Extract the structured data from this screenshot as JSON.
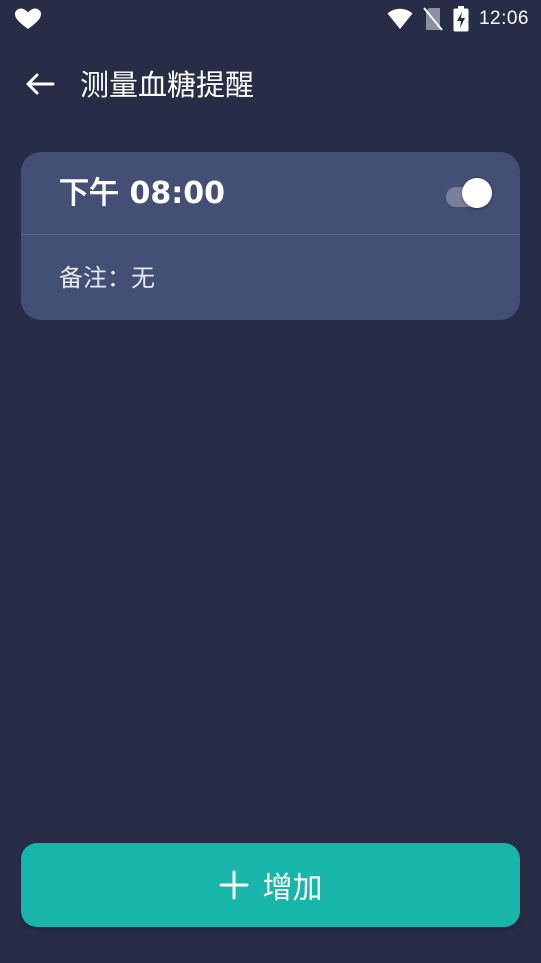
{
  "status_bar": {
    "time": "12:06",
    "icons": [
      "app-heart-icon",
      "wifi-icon",
      "no-sim-icon",
      "battery-charging-icon"
    ]
  },
  "toolbar": {
    "title": "测量血糖提醒",
    "back_icon": "arrow-left-icon"
  },
  "reminders": [
    {
      "time": "下午 08:00",
      "enabled": true,
      "note": "备注：无"
    }
  ],
  "add_button": {
    "label": "增加",
    "icon": "plus-icon"
  },
  "colors": {
    "background": "#272c47",
    "card": "#444f76",
    "accent": "#18b5aa",
    "text": "#ffffff"
  }
}
